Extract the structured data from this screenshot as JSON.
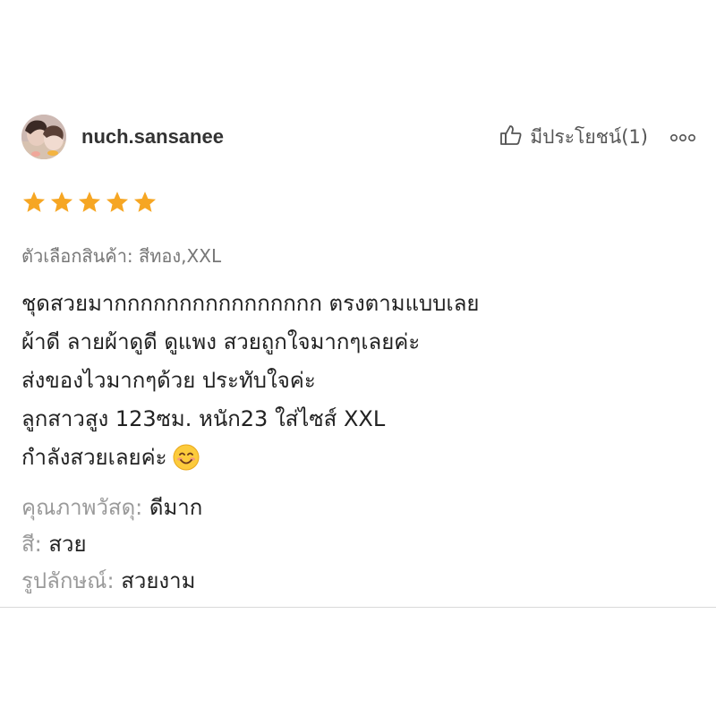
{
  "review": {
    "username": "nuch.sansanee",
    "helpful_label": "มีประโยชน์(1)",
    "rating": 5,
    "variant": "ตัวเลือกสินค้า: สีทอง,XXL",
    "body_lines": [
      "ชุดสวยมากกกกกกกกกกกกกกกก ตรงตามแบบเลย",
      "ผ้าดี ลายผ้าดูดี ดูแพง สวยถูกใจมากๆเลยค่ะ",
      "ส่งของไวมากๆด้วย ประทับใจค่ะ",
      "ลูกสาวสูง 123ซม. หนัก23 ใส่ไซส์ XXL",
      "กำลังสวยเลยค่ะ"
    ],
    "attributes": [
      {
        "label": "คุณภาพวัสดุ:",
        "value": "ดีมาก"
      },
      {
        "label": "สี:",
        "value": "สวย"
      },
      {
        "label": "รูปลักษณ์:",
        "value": "สวยงาม"
      }
    ],
    "icons": {
      "like": "thumbs-up-icon",
      "more": "more-dots-icon",
      "star": "star-icon",
      "emoji": "smiling-face-emoji"
    },
    "colors": {
      "star": "#f6a623",
      "text": "#222222",
      "muted": "#9a9a9a"
    }
  }
}
